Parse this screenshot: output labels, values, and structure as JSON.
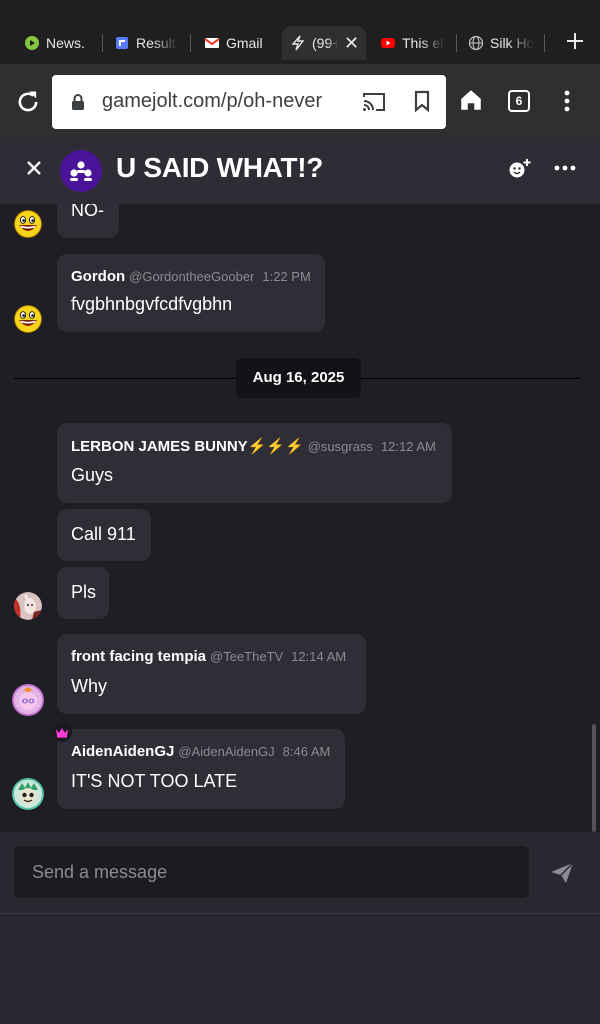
{
  "browser": {
    "tabs": [
      {
        "title": "News.",
        "icon": "rumble-icon",
        "color": "#85c742"
      },
      {
        "title": "Result",
        "icon": "results-icon",
        "color": "#5b7cfa"
      },
      {
        "title": "Gmail",
        "icon": "gmail-icon",
        "color": "#ea4335"
      },
      {
        "title": "(99+",
        "icon": "gamejolt-icon",
        "color": "#ccff00",
        "active": true
      },
      {
        "title": "This el",
        "icon": "youtube-icon",
        "color": "#ff0000"
      },
      {
        "title": "Silk Ho",
        "icon": "globe-icon",
        "color": "#bdbdbd"
      }
    ],
    "url": "gamejolt.com/p/oh-never",
    "tab_count": "6"
  },
  "chat": {
    "title": "U SAID WHAT!?",
    "messages": [
      {
        "id": "m1",
        "text": "NO-"
      },
      {
        "id": "m2",
        "name": "Gordon",
        "handle": "@GordontheeGoober",
        "time": "1:22 PM",
        "text": "fvgbhnbgvfcdfvgbhn"
      },
      {
        "id": "m3",
        "name": "LERBON JAMES BUNNY⚡⚡⚡",
        "handle": "@susgrass",
        "time": "12:12 AM",
        "text": "Guys"
      },
      {
        "id": "m4",
        "text": "Call 911"
      },
      {
        "id": "m5",
        "text": "Pls"
      },
      {
        "id": "m6",
        "name": "front facing tempia",
        "handle": "@TeeTheTV",
        "time": "12:14 AM",
        "text": "Why"
      },
      {
        "id": "m7",
        "name": "AidenAidenGJ",
        "handle": "@AidenAidenGJ",
        "time": "8:46 AM",
        "text": "IT'S NOT TOO LATE"
      }
    ],
    "date_divider": "Aug 16, 2025",
    "composer_placeholder": "Send a message"
  },
  "colors": {
    "accent": "#4a1499",
    "bubble": "#2f2d35",
    "background": "#201e25"
  }
}
